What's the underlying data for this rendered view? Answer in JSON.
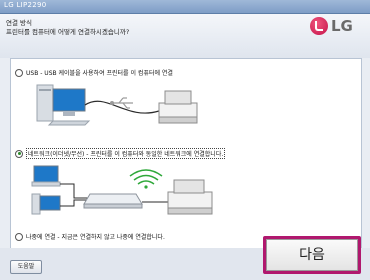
{
  "window": {
    "title": "LG LIP2290"
  },
  "header": {
    "heading": "연결 방식",
    "question": "프린터를 컴퓨터에 어떻게 연결하시겠습니까?",
    "logo_text": "LG"
  },
  "options": [
    {
      "label": "USB - USB 케이블을 사용하여 프린터를 이 컴퓨터에 연결",
      "selected": false
    },
    {
      "label": "네트워크(이더넷/무선) - 프린터를 이 컴퓨터와 동일한 네트워크에 연결합니다.",
      "selected": true
    },
    {
      "label": "나중에 연결 - 지금은 연결하지 않고 나중에 연결합니다.",
      "selected": false
    }
  ],
  "buttons": {
    "help": "도움말",
    "next": "다음"
  },
  "colors": {
    "accent": "#b0186e",
    "brand": "#c4124a"
  }
}
